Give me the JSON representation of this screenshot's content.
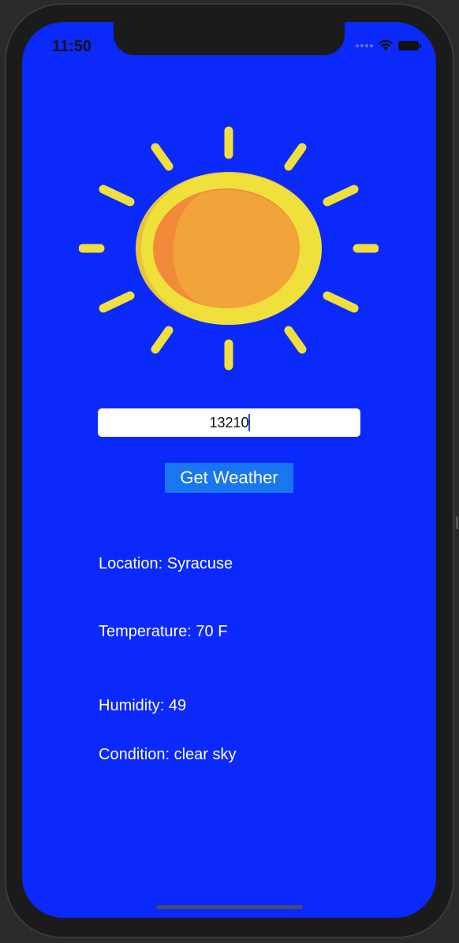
{
  "status_bar": {
    "time": "11:50"
  },
  "icons": {
    "weather": "sun-icon",
    "wifi": "wifi-icon",
    "battery": "battery-icon",
    "signal": "signal-icon"
  },
  "colors": {
    "background": "#0b29fb",
    "button": "#1877ee",
    "sun_ray": "#f1df3b",
    "sun_outer": "#e9c43a",
    "sun_inner": "#f2a33a"
  },
  "search": {
    "value": "13210"
  },
  "actions": {
    "get_weather_label": "Get Weather"
  },
  "weather": {
    "location": "Location: Syracuse",
    "temperature": "Temperature: 70 F",
    "humidity": "Humidity: 49",
    "condition": "Condition: clear sky"
  }
}
